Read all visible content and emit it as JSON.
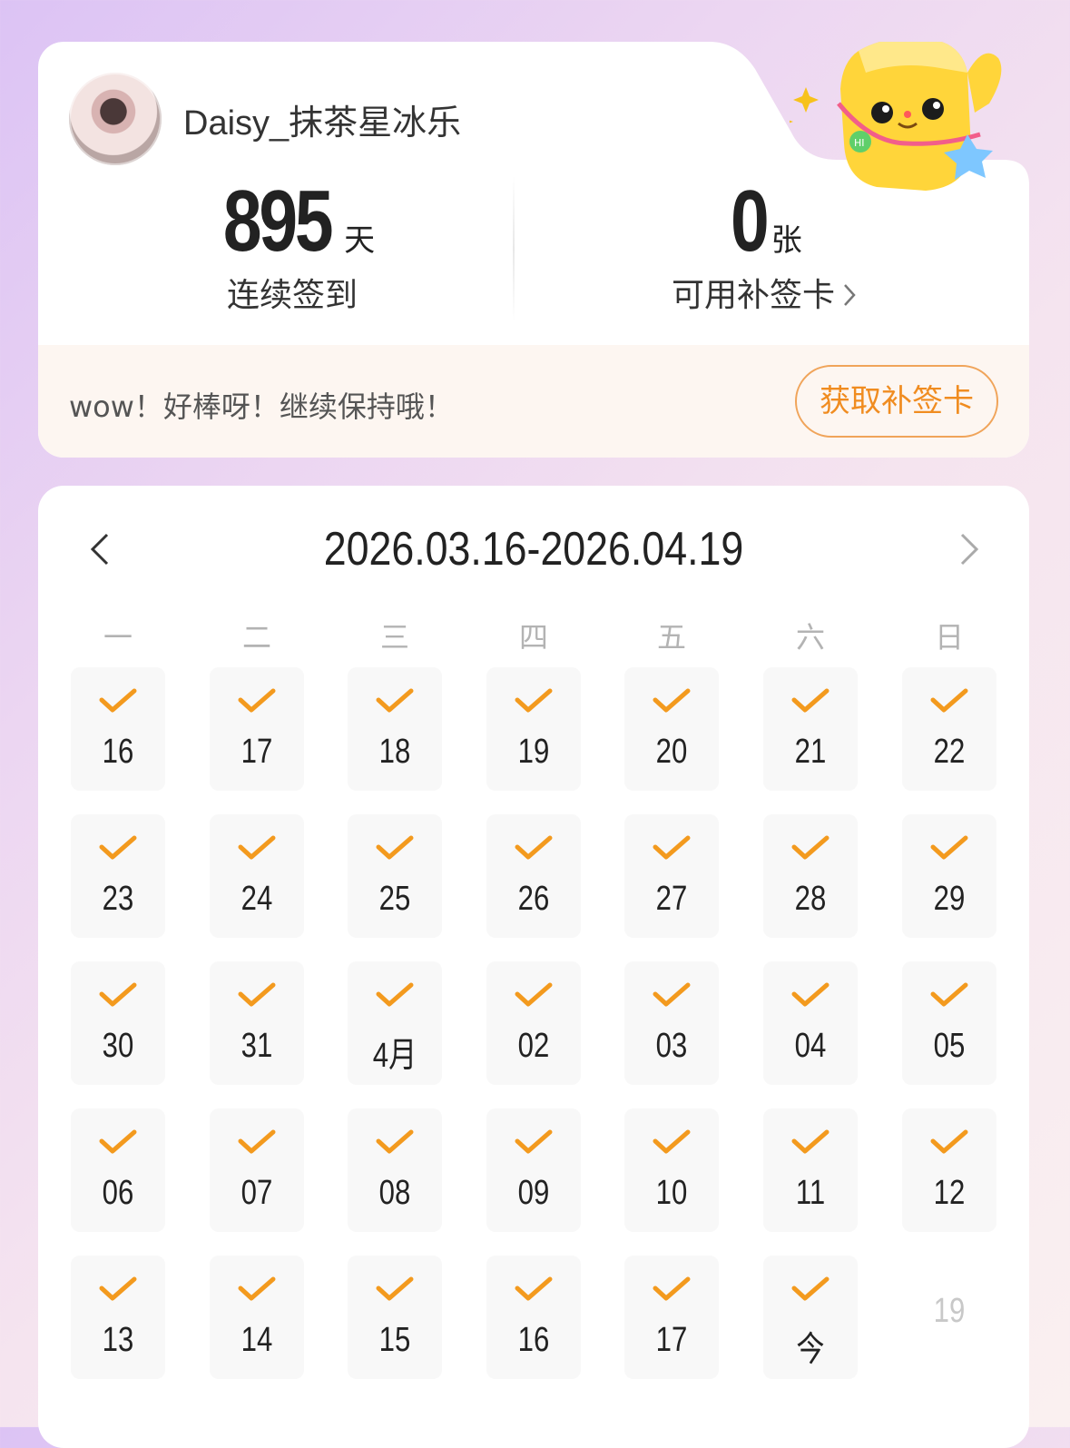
{
  "user": {
    "username": "Daisy_抹茶星冰乐"
  },
  "stats": {
    "streak_value": "895",
    "streak_unit": "天",
    "streak_label": "连续签到",
    "cards_value": "0",
    "cards_unit": "张",
    "cards_label": "可用补签卡"
  },
  "banner": {
    "message": "wow！好棒呀！继续保持哦！",
    "button_label": "获取补签卡"
  },
  "calendar": {
    "range": "2026.03.16-2026.04.19",
    "weekdays": [
      "一",
      "二",
      "三",
      "四",
      "五",
      "六",
      "日"
    ],
    "days": [
      {
        "label": "16",
        "checked": true
      },
      {
        "label": "17",
        "checked": true
      },
      {
        "label": "18",
        "checked": true
      },
      {
        "label": "19",
        "checked": true
      },
      {
        "label": "20",
        "checked": true
      },
      {
        "label": "21",
        "checked": true
      },
      {
        "label": "22",
        "checked": true
      },
      {
        "label": "23",
        "checked": true
      },
      {
        "label": "24",
        "checked": true
      },
      {
        "label": "25",
        "checked": true
      },
      {
        "label": "26",
        "checked": true
      },
      {
        "label": "27",
        "checked": true
      },
      {
        "label": "28",
        "checked": true
      },
      {
        "label": "29",
        "checked": true
      },
      {
        "label": "30",
        "checked": true
      },
      {
        "label": "31",
        "checked": true
      },
      {
        "label": "4月",
        "checked": true
      },
      {
        "label": "02",
        "checked": true
      },
      {
        "label": "03",
        "checked": true
      },
      {
        "label": "04",
        "checked": true
      },
      {
        "label": "05",
        "checked": true
      },
      {
        "label": "06",
        "checked": true
      },
      {
        "label": "07",
        "checked": true
      },
      {
        "label": "08",
        "checked": true
      },
      {
        "label": "09",
        "checked": true
      },
      {
        "label": "10",
        "checked": true
      },
      {
        "label": "11",
        "checked": true
      },
      {
        "label": "12",
        "checked": true
      },
      {
        "label": "13",
        "checked": true
      },
      {
        "label": "14",
        "checked": true
      },
      {
        "label": "15",
        "checked": true
      },
      {
        "label": "16",
        "checked": true
      },
      {
        "label": "17",
        "checked": true
      },
      {
        "label": "今",
        "checked": true
      },
      {
        "label": "19",
        "checked": false
      }
    ]
  },
  "colors": {
    "accent": "#f39a1e",
    "button_border": "#f0a45a",
    "button_text": "#f08c20"
  },
  "icons": {
    "prev": "chevron-left-icon",
    "next": "chevron-right-icon",
    "check": "checkmark-icon"
  }
}
